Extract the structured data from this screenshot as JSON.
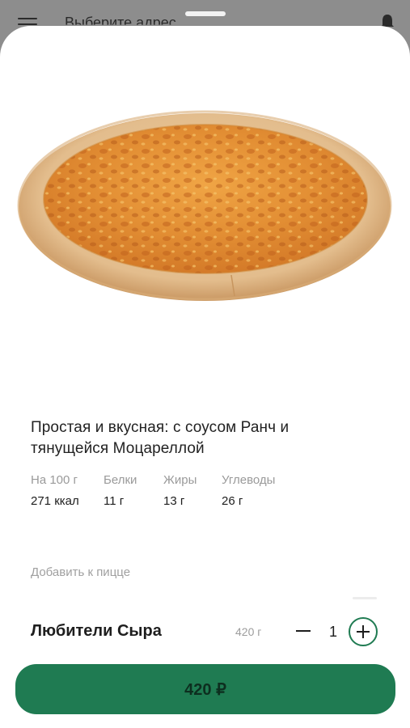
{
  "background_screen": {
    "title": "Выберите адрес",
    "menu_icon": "hamburger-menu-icon",
    "bell_icon": "bell-icon"
  },
  "product": {
    "image": "cheese-pizza-photo",
    "description": "Простая и вкусная: с соусом Ранч и тянущейся Моцареллой",
    "nutrition": [
      {
        "label": "На 100 г",
        "value": "271 ккал"
      },
      {
        "label": "Белки",
        "value": "11 г"
      },
      {
        "label": "Жиры",
        "value": "13 г"
      },
      {
        "label": "Углеводы",
        "value": "26 г"
      }
    ],
    "addons_label": "Добавить к пицце",
    "name": "Любители Сыра",
    "weight": "420 г",
    "quantity": "1",
    "price_button": "420 ₽"
  },
  "colors": {
    "accent": "#1f7b52",
    "button_text": "#0d2e1f",
    "overlay": "#8d8d8d"
  }
}
